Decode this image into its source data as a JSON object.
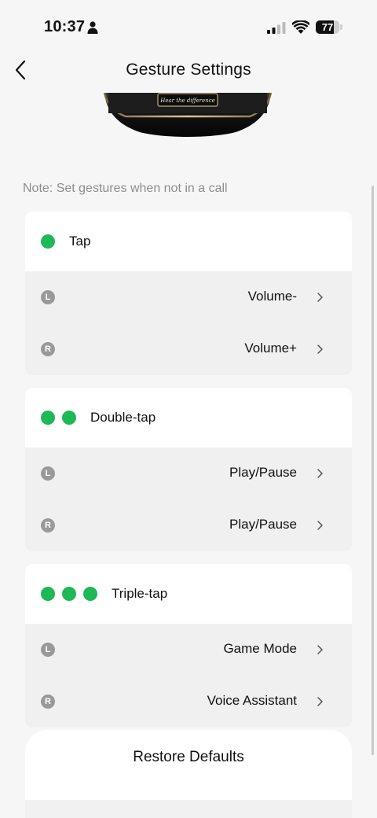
{
  "status_bar": {
    "time": "10:37",
    "battery": "77",
    "battery_level": 0.77
  },
  "header": {
    "title": "Gesture Settings"
  },
  "product_image": {
    "engraving": "Hear the difference"
  },
  "note": "Note: Set gestures when not in a call",
  "gestures": [
    {
      "title": "Tap",
      "dots": 1,
      "rows": [
        {
          "side": "L",
          "value": "Volume-"
        },
        {
          "side": "R",
          "value": "Volume+"
        }
      ]
    },
    {
      "title": "Double-tap",
      "dots": 2,
      "rows": [
        {
          "side": "L",
          "value": "Play/Pause"
        },
        {
          "side": "R",
          "value": "Play/Pause"
        }
      ]
    },
    {
      "title": "Triple-tap",
      "dots": 3,
      "rows": [
        {
          "side": "L",
          "value": "Game Mode"
        },
        {
          "side": "R",
          "value": "Voice Assistant"
        }
      ]
    }
  ],
  "restore": {
    "label": "Restore Defaults"
  },
  "colors": {
    "accent_green": "#1db954",
    "background": "#f6f6f6",
    "badge_gray": "#999999"
  }
}
